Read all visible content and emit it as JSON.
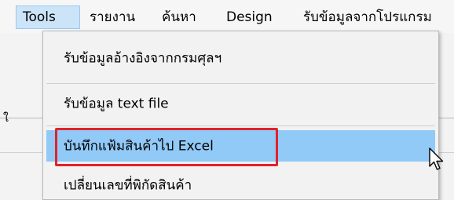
{
  "menubar": {
    "items": [
      {
        "label": "Tools",
        "active": true
      },
      {
        "label": "รายงาน",
        "active": false
      },
      {
        "label": "ค้นหา",
        "active": false
      },
      {
        "label": "Design",
        "active": false
      },
      {
        "label": "รับข้อมูลจากโปรแกรม",
        "active": false
      }
    ]
  },
  "tools_menu": {
    "items": [
      {
        "label": "รับข้อมูลอ้างอิงจากกรมศุลฯ"
      },
      {
        "label": "รับข้อมูล text file"
      },
      {
        "label": "บันทึกแฟ้มสินค้าไป Excel",
        "highlighted": true
      },
      {
        "label": "เปลี่ยนเลขที่พิกัดสินค้า"
      }
    ]
  },
  "background": {
    "partial_glyph": "ใ"
  },
  "colors": {
    "menu_highlight": "#91c9f7",
    "menubar_active": "#cce4f7",
    "annotation_red": "#e0232a"
  },
  "icons": {
    "cursor": "arrow-pointer-icon"
  }
}
